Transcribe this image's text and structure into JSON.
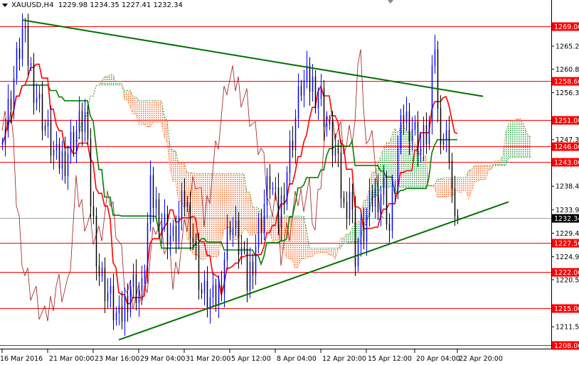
{
  "header": {
    "symbol": "XAUUSD,H4",
    "open": "1229.98",
    "high": "1234.35",
    "low": "1227.41",
    "close": "1232.34"
  },
  "colors": {
    "level": "#ff0000",
    "trend": "#007000",
    "bull": "#0000ff",
    "bear": "#000000",
    "current": "#000000"
  },
  "chart_data": {
    "type": "candlestick",
    "title": "XAUUSD,H4",
    "ylim": [
      1207.0,
      1271.0
    ],
    "price_ticks": [
      "1265.20",
      "1260.80",
      "1256.30",
      "1247.30",
      "1238.40",
      "1233.90",
      "1229.40",
      "1224.90",
      "1220.50",
      "1211.50"
    ],
    "levels": [
      {
        "label": "1269.00",
        "value": 1269.0
      },
      {
        "label": "1258.60",
        "value": 1258.6
      },
      {
        "label": "1251.00",
        "value": 1251.0
      },
      {
        "label": "1246.00",
        "value": 1246.0
      },
      {
        "label": "1243.00",
        "value": 1243.0
      },
      {
        "label": "1227.50",
        "value": 1227.5
      },
      {
        "label": "1222.00",
        "value": 1222.0
      },
      {
        "label": "1215.00",
        "value": 1215.0
      },
      {
        "label": "1208.00",
        "value": 1208.0
      }
    ],
    "current_price": {
      "label": "1232.34",
      "value": 1232.34
    },
    "time_labels": [
      {
        "label": "16 Mar 2016",
        "bar": 0
      },
      {
        "label": "21 Mar 00:00",
        "bar": 16
      },
      {
        "label": "23 Mar 16:00",
        "bar": 32
      },
      {
        "label": "29 Mar 04:00",
        "bar": 48
      },
      {
        "label": "31 Mar 20:00",
        "bar": 64
      },
      {
        "label": "5 Apr 12:00",
        "bar": 80
      },
      {
        "label": "8 Apr 04:00",
        "bar": 96
      },
      {
        "label": "12 Apr 20:00",
        "bar": 112
      },
      {
        "label": "15 Apr 12:00",
        "bar": 128
      },
      {
        "label": "20 Apr 04:00",
        "bar": 145
      },
      {
        "label": "22 Apr 20:00",
        "bar": 160
      }
    ],
    "close_anchors": [
      [
        1,
        1250
      ],
      [
        5,
        1262
      ],
      [
        7,
        1268
      ],
      [
        11,
        1258
      ],
      [
        15,
        1250
      ],
      [
        19,
        1243
      ],
      [
        22,
        1244
      ],
      [
        25,
        1248
      ],
      [
        29,
        1252
      ],
      [
        31,
        1236
      ],
      [
        34,
        1222
      ],
      [
        37,
        1218
      ],
      [
        41,
        1212
      ],
      [
        45,
        1220
      ],
      [
        49,
        1218
      ],
      [
        52,
        1237
      ],
      [
        56,
        1232
      ],
      [
        60,
        1228
      ],
      [
        64,
        1236
      ],
      [
        66,
        1232
      ],
      [
        70,
        1218
      ],
      [
        74,
        1216
      ],
      [
        76,
        1218
      ],
      [
        80,
        1232
      ],
      [
        84,
        1226
      ],
      [
        86,
        1220
      ],
      [
        90,
        1230
      ],
      [
        94,
        1240
      ],
      [
        97,
        1232
      ],
      [
        101,
        1245
      ],
      [
        105,
        1258
      ],
      [
        109,
        1258
      ],
      [
        112,
        1255
      ],
      [
        115,
        1248
      ],
      [
        117,
        1245
      ],
      [
        120,
        1234
      ],
      [
        122,
        1238
      ],
      [
        124,
        1226
      ],
      [
        127,
        1230
      ],
      [
        130,
        1236
      ],
      [
        134,
        1238
      ],
      [
        136,
        1230
      ],
      [
        139,
        1245
      ],
      [
        141,
        1252
      ],
      [
        144,
        1250
      ],
      [
        147,
        1246
      ],
      [
        150,
        1250
      ],
      [
        152,
        1266
      ],
      [
        153,
        1252
      ],
      [
        155,
        1248
      ],
      [
        157,
        1246
      ],
      [
        159,
        1230
      ],
      [
        160,
        1232.34
      ]
    ],
    "trendlines": [
      {
        "name": "upper",
        "from": [
          7,
          1270.2
        ],
        "to": [
          169,
          1255.6
        ]
      },
      {
        "name": "lower",
        "from": [
          41,
          1209.0
        ],
        "to": [
          178,
          1235.4
        ]
      }
    ]
  }
}
